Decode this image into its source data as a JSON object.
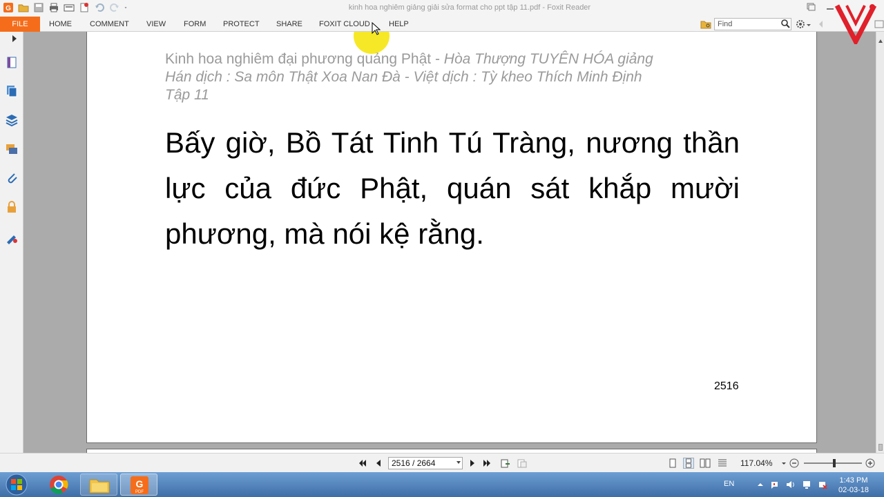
{
  "window": {
    "title": "kinh hoa nghiêm giảng giải sửa format cho ppt tập 11.pdf - Foxit Reader"
  },
  "ribbon": {
    "tabs": [
      "FILE",
      "HOME",
      "COMMENT",
      "VIEW",
      "FORM",
      "PROTECT",
      "SHARE",
      "FOXIT CLOUD",
      "HELP"
    ],
    "find_placeholder": "Find"
  },
  "document": {
    "header_line1_regular": "Kinh hoa nghiêm đại phương quảng Phật - ",
    "header_line1_italic": "Hòa Thượng TUYÊN HÓA giảng",
    "header_line2": "Hán dịch : Sa môn Thật Xoa Nan Đà - Việt dịch : Tỳ kheo Thích Minh Định",
    "header_line3": "Tập 11",
    "body": "Bấy giờ, Bồ Tát Tinh Tú Tràng, nương thần lực của đức Phật, quán sát khắp mười phương, mà nói kệ rằng.",
    "page_number": "2516"
  },
  "statusbar": {
    "page_display": "2516 / 2664",
    "zoom": "117.04%"
  },
  "taskbar": {
    "lang": "EN",
    "time": "1:43 PM",
    "date": "02-03-18"
  },
  "colors": {
    "accent": "#f56d1a",
    "header_text": "#9a9a9a",
    "logo_red": "#e0202a"
  }
}
